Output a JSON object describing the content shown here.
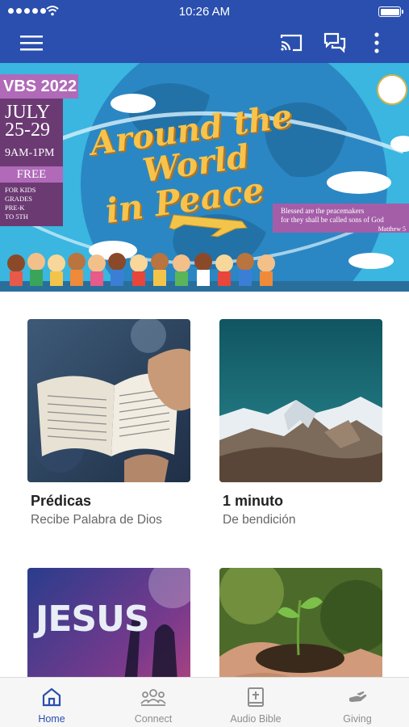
{
  "status_bar": {
    "time": "10:26 AM",
    "signal_dots": 5,
    "battery_level": 1.0
  },
  "app_bar": {
    "menu_icon": "hamburger-menu-icon",
    "cast_icon": "cast-icon",
    "chat_icon": "chat-bubbles-icon",
    "more_icon": "more-vertical-icon",
    "background": "#2a4fae"
  },
  "banner": {
    "event_label": "VBS 2022",
    "date": "JULY 25-29",
    "time": "9AM-1PM",
    "price": "FREE",
    "audience": "FOR KIDS\nGRADES\nPRE-K\nTO 5TH",
    "title_line1": "Around the World",
    "title_line2": "in Peace",
    "verse": "Blessed are the peacemakers\nfor they shall be called sons of God",
    "verse_ref": "Matthew 5"
  },
  "cards": [
    {
      "title": "Prédicas",
      "subtitle": "Recibe Palabra de Dios",
      "image": "open-bible-photo"
    },
    {
      "title": "1 minuto",
      "subtitle": "De bendición",
      "image": "mountain-range-photo"
    },
    {
      "title": "",
      "subtitle": "",
      "image": "jesus-worship-photo",
      "image_text": "JESUS"
    },
    {
      "title": "",
      "subtitle": "",
      "image": "hands-holding-seedling-photo"
    }
  ],
  "tabs": [
    {
      "label": "Home",
      "icon": "home-icon",
      "active": true
    },
    {
      "label": "Connect",
      "icon": "group-icon",
      "active": false
    },
    {
      "label": "Audio Bible",
      "icon": "bible-icon",
      "active": false
    },
    {
      "label": "Giving",
      "icon": "giving-hand-icon",
      "active": false
    }
  ],
  "colors": {
    "accent": "#2a4fae",
    "inactive_tab": "#8e8e8e"
  }
}
